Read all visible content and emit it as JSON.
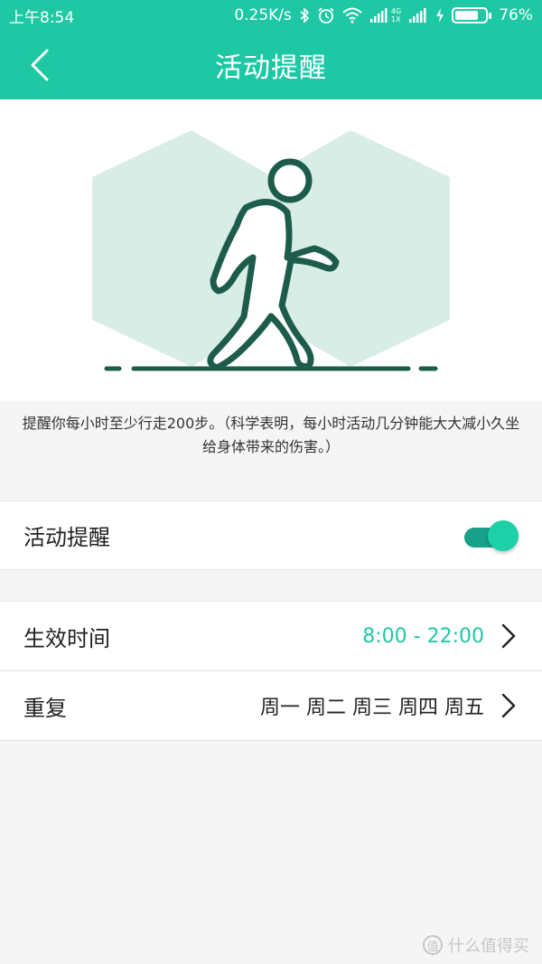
{
  "status_bar": {
    "time": "上午8:54",
    "network_speed": "0.25K/s",
    "network_type_top": "4G",
    "network_type_bottom": "1X",
    "battery_percent": "76%",
    "battery_level": 0.76,
    "icons": [
      "bluetooth-icon",
      "alarm-icon",
      "wifi-icon",
      "signal-icon",
      "signal-icon",
      "charging-icon",
      "battery-icon"
    ]
  },
  "app_bar": {
    "title": "活动提醒",
    "back_icon": "chevron-left-icon"
  },
  "hero": {
    "illustration": "walking-person",
    "accent_color": "#1d5c4a",
    "hexagon_color": "#d9ede7"
  },
  "description": "提醒你每小时至少行走200步。（科学表明，每小时活动几分钟能大大减小久坐给身体带来的伤害。）",
  "settings": {
    "reminder": {
      "label": "活动提醒",
      "enabled": true
    },
    "effective_time": {
      "label": "生效时间",
      "value": "8:00 - 22:00"
    },
    "repeat": {
      "label": "重复",
      "value": "周一 周二 周三 周四 周五"
    }
  },
  "watermark": {
    "badge": "值",
    "text": "什么值得买"
  },
  "colors": {
    "primary": "#1ec8a5",
    "toggle_track": "#17a18a",
    "background": "#f5f5f5"
  }
}
